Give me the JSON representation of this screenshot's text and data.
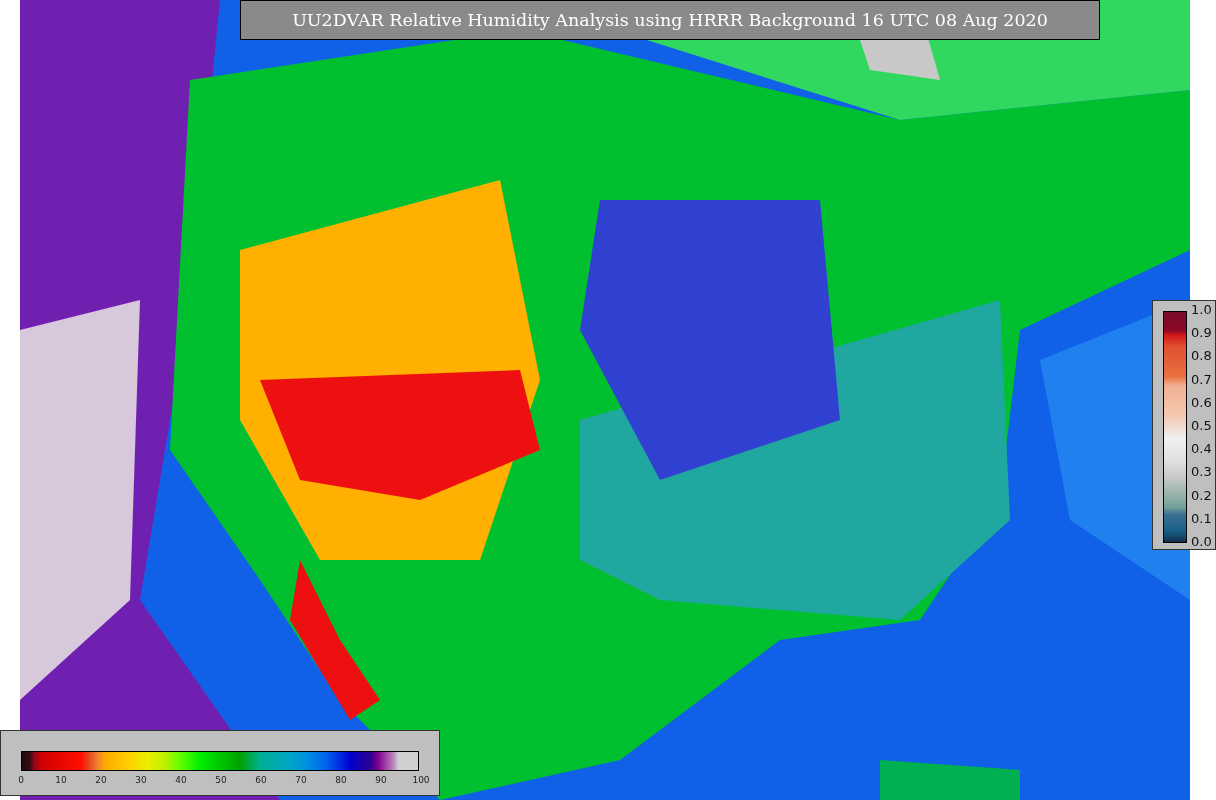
{
  "title": "UU2DVAR Relative Humidity Analysis using HRRR Background 16 UTC 08 Aug 2020",
  "humidity_colorbar": {
    "ticks": [
      "0",
      "10",
      "20",
      "30",
      "40",
      "50",
      "60",
      "70",
      "80",
      "90",
      "100"
    ]
  },
  "observation_colorbar": {
    "ticks": [
      "1.0",
      "0.9",
      "0.8",
      "0.7",
      "0.6",
      "0.5",
      "0.4",
      "0.3",
      "0.2",
      "0.1",
      "0.0"
    ]
  }
}
